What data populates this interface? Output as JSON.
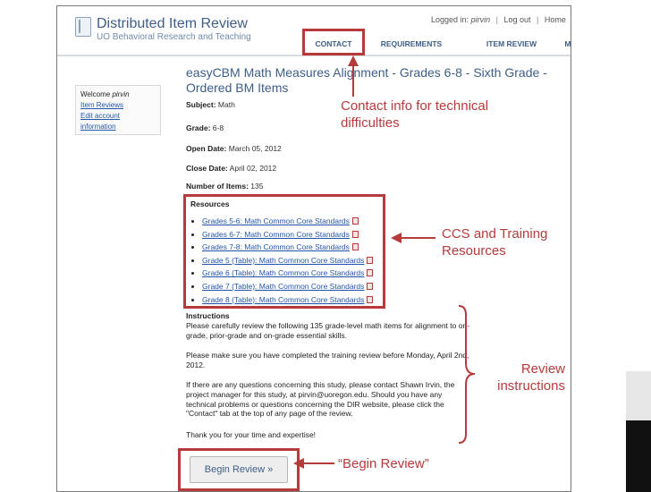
{
  "brand": {
    "title": "Distributed Item Review",
    "subtitle": "UO Behavioral Research and Teaching"
  },
  "top_links": {
    "logged_in_prefix": "Logged in:",
    "username": "pirvin",
    "logout": "Log out",
    "home": "Home"
  },
  "nav": {
    "tabs": [
      {
        "label": "CONTACT"
      },
      {
        "label": "REQUIREMENTS"
      },
      {
        "label": "ITEM REVIEW"
      },
      {
        "label": "MY ACCOUNT"
      }
    ]
  },
  "sidebar": {
    "welcome_prefix": "Welcome",
    "username": "pirvin",
    "links": [
      "Item Reviews",
      "Edit account information"
    ]
  },
  "main": {
    "title": "easyCBM Math Measures Alignment - Grades 6-8 - Sixth Grade - Ordered BM Items",
    "fields": [
      {
        "label": "Subject:",
        "value": "Math"
      },
      {
        "label": "Grade:",
        "value": "6-8"
      },
      {
        "label": "Open Date:",
        "value": "March 05, 2012"
      },
      {
        "label": "Close Date:",
        "value": "April 02, 2012"
      },
      {
        "label": "Number of Items:",
        "value": "135"
      }
    ],
    "resources_heading": "Resources",
    "resources": [
      "Grades 5-6: Math Common Core Standards",
      "Grades 6-7: Math Common Core Standards",
      "Grades 7-8: Math Common Core Standards",
      "Grade 5 (Table): Math Common Core Standards",
      "Grade 6 (Table): Math Common Core Standards",
      "Grade 7 (Table): Math Common Core Standards",
      "Grade 8 (Table): Math Common Core Standards"
    ],
    "instructions_heading": "Instructions",
    "instructions": [
      "Please carefully review the following 135 grade-level math items for alignment to on-grade, prior-grade and on-grade essential skills.",
      "Please make sure you have completed the training review before Monday, April 2nd, 2012.",
      "If there are any questions concerning this study, please contact Shawn Irvin, the project manager for this study, at pirvin@uoregon.edu.  Should you have any technical problems or questions concerning the DIR website, please click the \"Contact\" tab at the top of any page of the review.",
      "Thank you for your time and expertise!"
    ],
    "begin_button": "Begin Review »"
  },
  "annotations": {
    "contact": "Contact info for technical difficulties",
    "ccs": "CCS and Training Resources",
    "review": "Review instructions",
    "begin": "“Begin Review”"
  },
  "colors": {
    "annotation": "#b73a3a",
    "brand": "#3d5e87",
    "link": "#2255aa"
  }
}
